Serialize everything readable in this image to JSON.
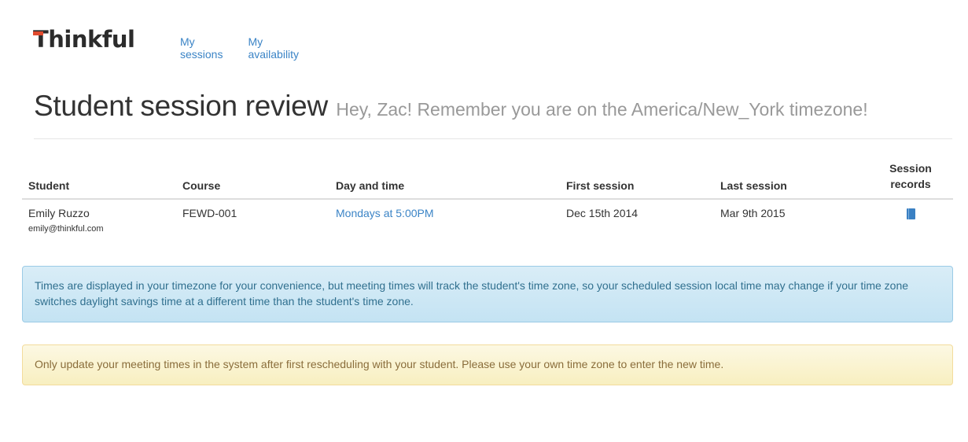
{
  "brand": {
    "name": "Thinkful",
    "accent_color": "#e14b2e"
  },
  "nav": {
    "links": [
      {
        "label": "My sessions"
      },
      {
        "label": "My availability"
      }
    ],
    "link_color": "#3b84c6"
  },
  "header": {
    "title": "Student session review",
    "subtitle": "Hey, Zac! Remember you are on the America/New_York timezone!"
  },
  "table": {
    "columns": [
      "Student",
      "Course",
      "Day and time",
      "First session",
      "Last session",
      "Session records"
    ],
    "rows": [
      {
        "student_name": "Emily Ruzzo",
        "student_email": "emily@thinkful.com",
        "course": "FEWD-001",
        "day_and_time": "Mondays at 5:00PM",
        "first_session": "Dec 15th 2014",
        "last_session": "Mar 9th 2015",
        "records_icon": "book-icon"
      }
    ]
  },
  "alerts": {
    "info": "Times are displayed in your timezone for your convenience, but meeting times will track the student's time zone, so your scheduled session local time may change if your time zone switches daylight savings time at a different time than the student's time zone.",
    "warning": "Only update your meeting times in the system after first rescheduling with your student. Please use your own time zone to enter the new time."
  }
}
